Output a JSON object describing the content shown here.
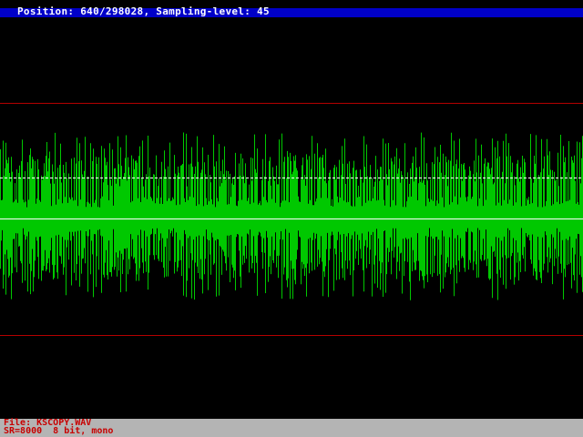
{
  "header": {
    "text": "Position: 640/298028, Sampling-level: 45",
    "position_current": 640,
    "position_total": 298028,
    "sampling_level": 45
  },
  "status": {
    "file_line": "File: KSCOPY.WAV",
    "format_line": "SR=8000  8 bit, mono"
  },
  "colors": {
    "background": "#000000",
    "header_bar": "#0000c8",
    "header_text": "#ffffff",
    "status_bar": "#b4b4b4",
    "status_text": "#c80000",
    "waveform": "#00c800",
    "limit_lines": "#b40000",
    "center_line": "#ffffff",
    "level_line": "#ffffff"
  }
}
